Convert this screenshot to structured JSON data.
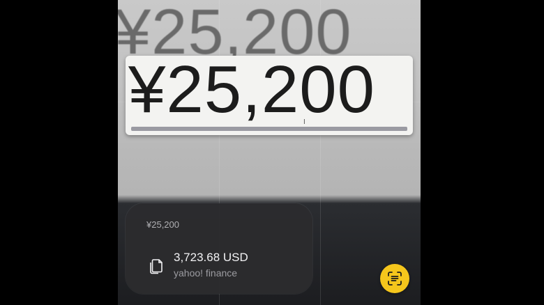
{
  "viewfinder": {
    "background_price": "¥25,200",
    "detected_text": "¥25,200",
    "cursor_glyph": "I"
  },
  "conversion_card": {
    "source_text": "¥25,200",
    "result_text": "3,723.68 USD",
    "provider": "yahoo! finance",
    "copy_icon": "copy-document-icon"
  },
  "scan_button": {
    "icon": "text-scan-icon",
    "color": "#f5c61c"
  },
  "colors": {
    "card_background": "#2c2c2e",
    "accent_yellow": "#f5c61c"
  }
}
